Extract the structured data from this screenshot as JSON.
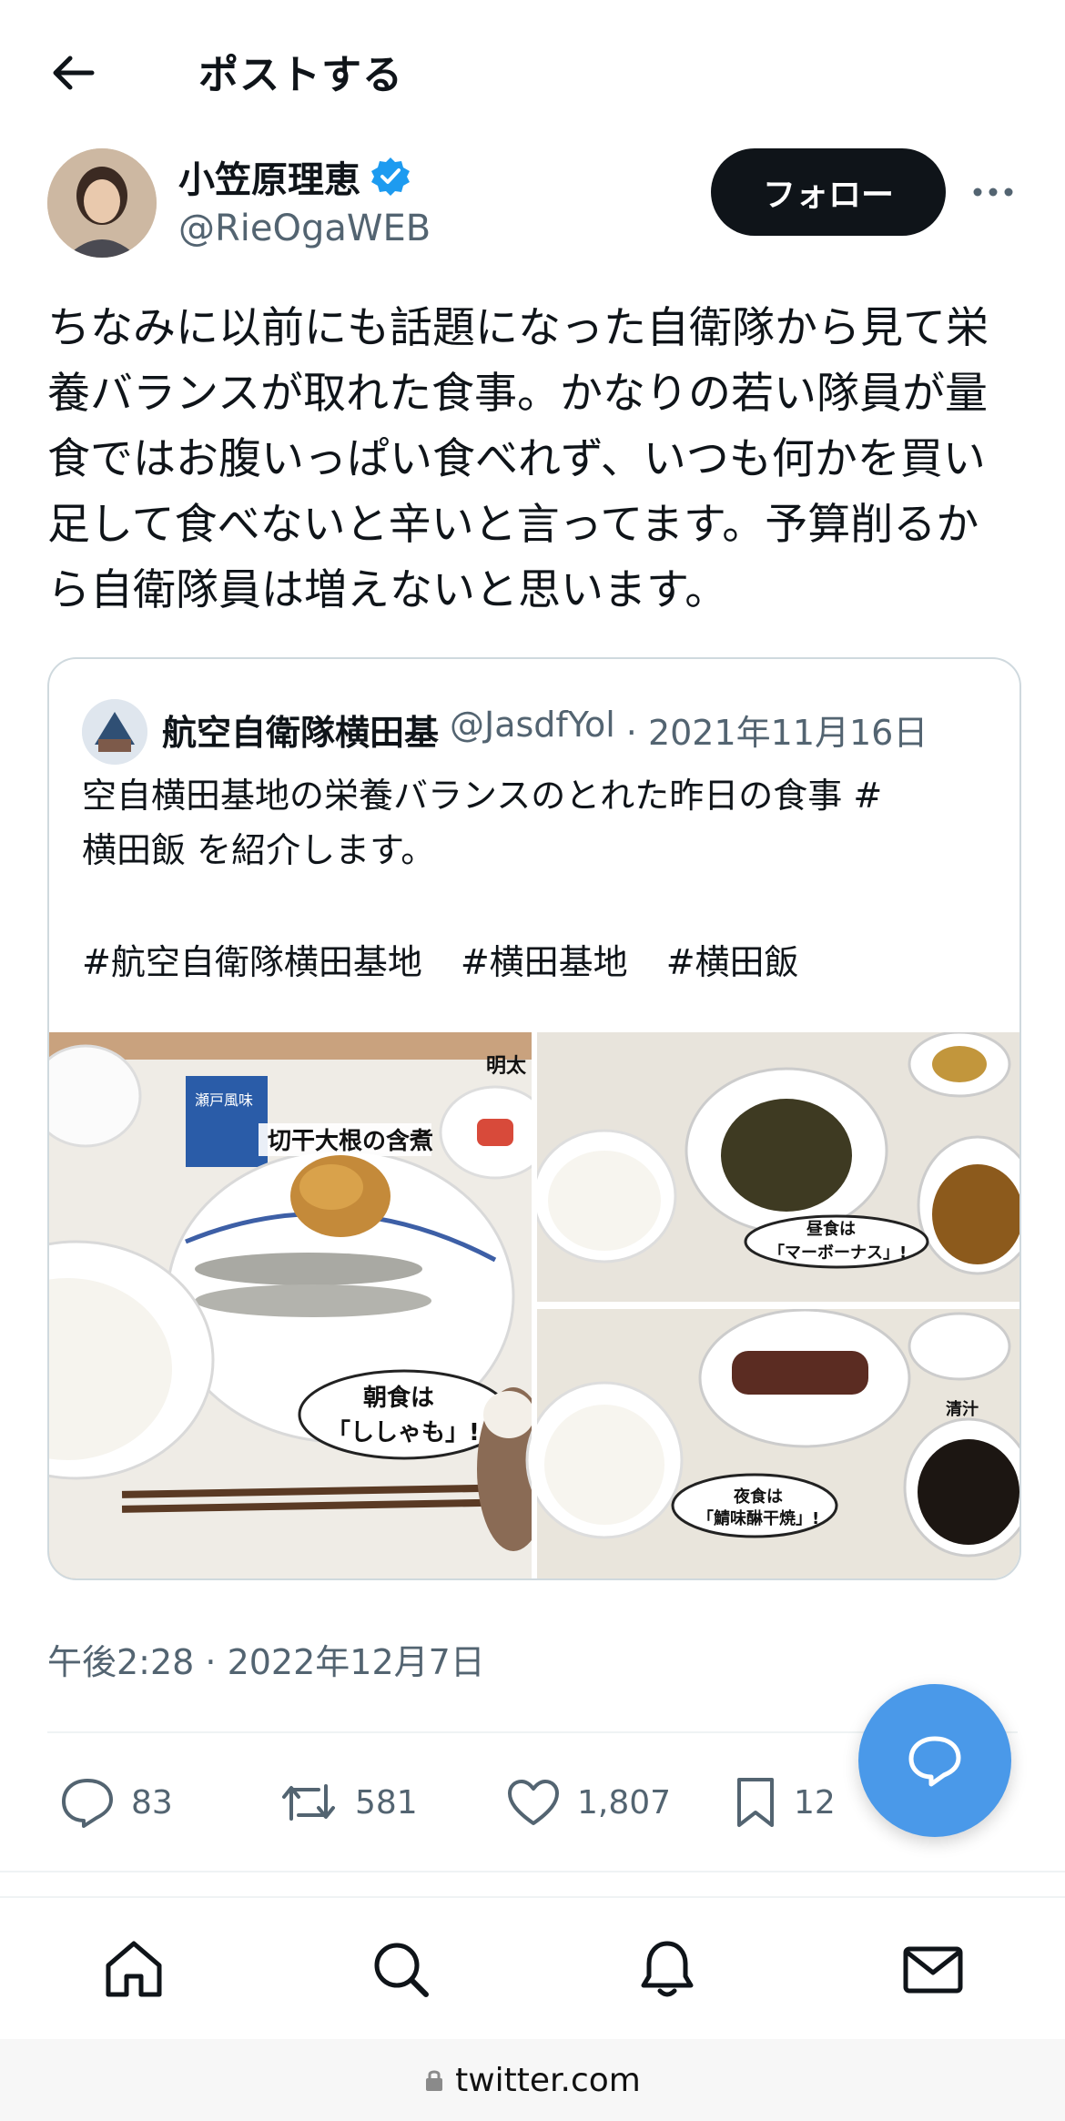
{
  "header": {
    "title": "ポストする",
    "back_icon": "arrow-left-icon"
  },
  "author": {
    "name": "小笠原理恵",
    "handle": "@RieOgaWEB",
    "verified_icon": "verified-badge-icon",
    "follow_label": "フォロー"
  },
  "tweet": {
    "text": "ちなみに以前にも話題になった自衛隊から見て栄\n養バランスが取れた食事。かなりの若い隊員が量\n食ではお腹いっぱい食べれず、いつも何かを買い\n足して食べないと辛いと言ってます。予算削るか\nら自衛隊員は増えないと思います。",
    "timestamp": "午後2:28 · 2022年12月7日"
  },
  "quote": {
    "name": "航空自衛隊横田基",
    "handle": "@JasdfYol",
    "date": "· 2021年11月16日",
    "text": "空自横田基地の栄養バランスのとれた昨日の食事 #\n横田飯 を紹介します。",
    "hashtags": [
      "#航空自衛隊横田基地",
      "#横田基地",
      "#横田飯"
    ],
    "images": {
      "breakfast_label": "切干大根の含煮",
      "breakfast_bubble_1": "朝食は",
      "breakfast_bubble_2": "「ししゃも」!",
      "packet_label": "瀬戸風味",
      "mentaiko_label": "明太",
      "lunch_bubble_1": "昼食は",
      "lunch_bubble_2": "「マーボーナス」!",
      "dinner_bubble_1": "夜食は",
      "dinner_bubble_2": "「鯖味醂干焼」!",
      "soup_label": "清汁"
    }
  },
  "actions": {
    "reply_count": "83",
    "retweet_count": "581",
    "like_count": "1,807",
    "bookmark_count": "12"
  },
  "browser": {
    "url": "twitter.com"
  },
  "colors": {
    "accent": "#4a99e9",
    "text": "#0f1419",
    "muted": "#536471",
    "verified": "#1d9bf0"
  }
}
